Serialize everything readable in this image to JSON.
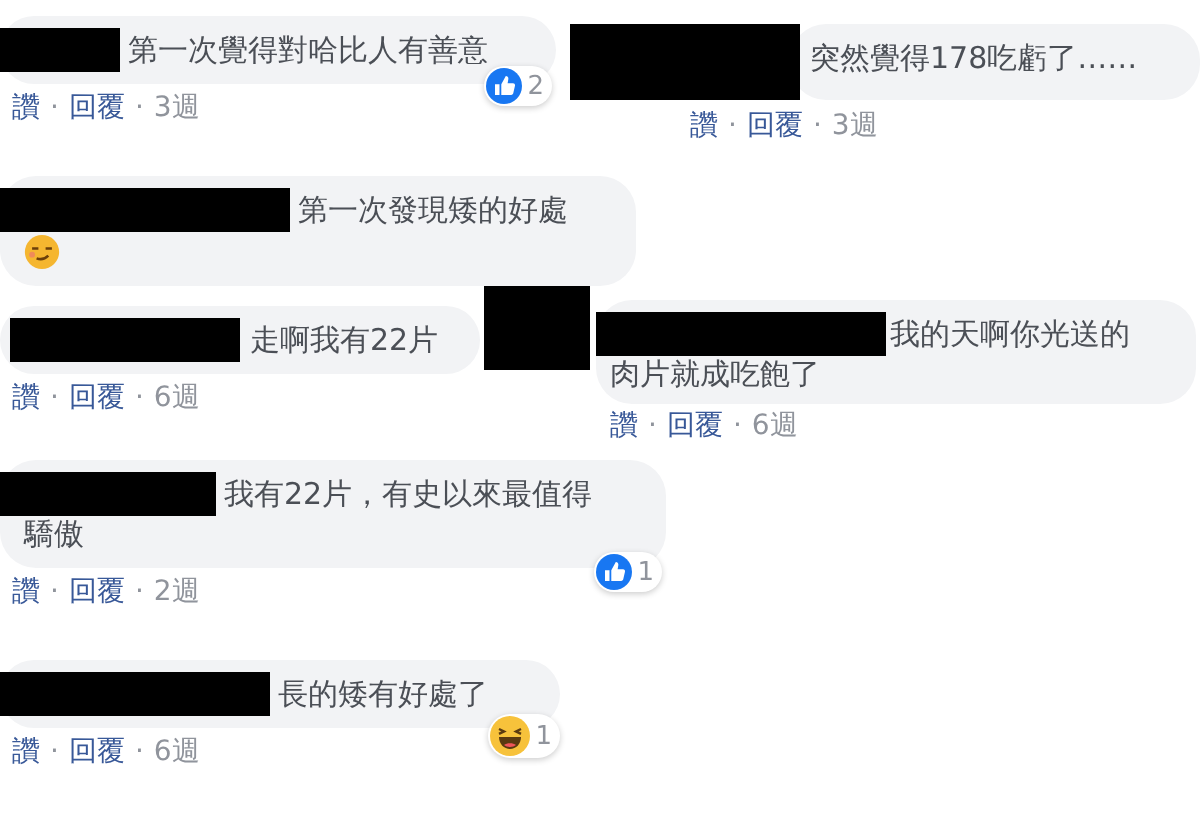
{
  "comments": [
    {
      "name_redacted": true,
      "lines": [
        "第一次覺得對哈比人有善意"
      ],
      "reaction": {
        "kind": "like",
        "count": "2"
      },
      "meta": [
        {
          "kind": "link",
          "text": "讚"
        },
        {
          "kind": "sep",
          "text": "·"
        },
        {
          "kind": "link",
          "text": "回覆"
        },
        {
          "kind": "sep",
          "text": "·"
        },
        {
          "kind": "time",
          "text": "3週"
        }
      ]
    },
    {
      "avatar_redacted": true,
      "lines": [
        "突然覺得178吃虧了……"
      ],
      "meta": [
        {
          "kind": "link",
          "text": "讚"
        },
        {
          "kind": "sep",
          "text": "·"
        },
        {
          "kind": "link",
          "text": "回覆"
        },
        {
          "kind": "sep",
          "text": "·"
        },
        {
          "kind": "time",
          "text": "3週"
        }
      ]
    },
    {
      "name_redacted": true,
      "lines": [
        "第一次發現矮的好處"
      ],
      "emoji": {
        "kind": "smirk"
      }
    },
    {
      "name_redacted": true,
      "lines": [
        "走啊我有22片"
      ],
      "meta": [
        {
          "kind": "link",
          "text": "讚"
        },
        {
          "kind": "sep",
          "text": "·"
        },
        {
          "kind": "link",
          "text": "回覆"
        },
        {
          "kind": "sep",
          "text": "·"
        },
        {
          "kind": "time",
          "text": "6週"
        }
      ]
    },
    {
      "name_redacted": true,
      "avatar_redacted": true,
      "lines": [
        "我的天啊你光送的",
        "肉片就成吃飽了"
      ],
      "meta": [
        {
          "kind": "link",
          "text": "讚"
        },
        {
          "kind": "sep",
          "text": "·"
        },
        {
          "kind": "link",
          "text": "回覆"
        },
        {
          "kind": "sep",
          "text": "·"
        },
        {
          "kind": "time",
          "text": "6週"
        }
      ]
    },
    {
      "name_redacted": true,
      "lines": [
        "我有22片，有史以來最值得",
        "驕傲"
      ],
      "reaction": {
        "kind": "like",
        "count": "1"
      },
      "meta": [
        {
          "kind": "link",
          "text": "讚"
        },
        {
          "kind": "sep",
          "text": "·"
        },
        {
          "kind": "link",
          "text": "回覆"
        },
        {
          "kind": "sep",
          "text": "·"
        },
        {
          "kind": "time",
          "text": "2週"
        }
      ]
    },
    {
      "name_redacted": true,
      "lines": [
        "長的矮有好處了"
      ],
      "reaction": {
        "kind": "haha",
        "count": "1"
      },
      "meta": [
        {
          "kind": "link",
          "text": "讚"
        },
        {
          "kind": "sep",
          "text": "·"
        },
        {
          "kind": "link",
          "text": "回覆"
        },
        {
          "kind": "sep",
          "text": "·"
        },
        {
          "kind": "time",
          "text": "6週"
        }
      ]
    }
  ]
}
